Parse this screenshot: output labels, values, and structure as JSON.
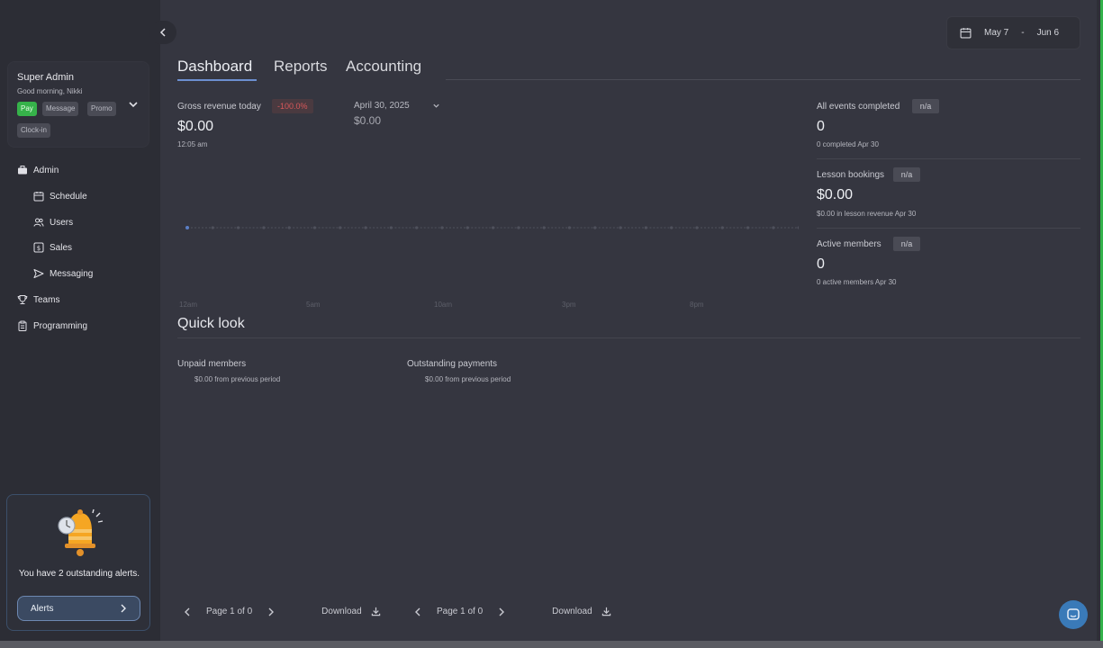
{
  "profile": {
    "name": "Super Admin",
    "greeting": "Good morning, Nikki",
    "chips": [
      "Pay",
      "Message",
      "Promo",
      "Clock-in"
    ]
  },
  "nav": {
    "admin": "Admin",
    "schedule": "Schedule",
    "users": "Users",
    "sales": "Sales",
    "messaging": "Messaging",
    "teams": "Teams",
    "programming": "Programming"
  },
  "alerts": {
    "message": "You have 2 outstanding alerts.",
    "button": "Alerts"
  },
  "date_range": {
    "start": "May 7",
    "separator": "-",
    "end": "Jun 6"
  },
  "tabs": [
    "Dashboard",
    "Reports",
    "Accounting"
  ],
  "revenue": {
    "label": "Gross revenue today",
    "change": "-100.0%",
    "value": "$0.00",
    "time": "12:05 am",
    "compare_date": "April 30, 2025",
    "compare_value": "$0.00"
  },
  "chart_data": {
    "type": "line",
    "x_tick_labels": [
      "12am",
      "5am",
      "10am",
      "3pm",
      "8pm"
    ],
    "points": 24,
    "values": [
      0,
      0,
      0,
      0,
      0,
      0,
      0,
      0,
      0,
      0,
      0,
      0,
      0,
      0,
      0,
      0,
      0,
      0,
      0,
      0,
      0,
      0,
      0,
      0,
      0
    ]
  },
  "stats": {
    "events": {
      "label": "All events completed",
      "badge": "n/a",
      "value": "0",
      "sub": "0 completed Apr 30"
    },
    "lessons": {
      "label": "Lesson bookings",
      "badge": "n/a",
      "value": "$0.00",
      "sub": "$0.00 in lesson revenue Apr 30"
    },
    "members": {
      "label": "Active members",
      "badge": "n/a",
      "value": "0",
      "sub": "0 active members Apr 30"
    }
  },
  "quick_look": {
    "title": "Quick look",
    "unpaid": {
      "label": "Unpaid members",
      "sub": "$0.00 from previous period"
    },
    "outstanding": {
      "label": "Outstanding payments",
      "sub": "$0.00 from previous period"
    }
  },
  "pagers": [
    {
      "page_text": "Page 1 of 0",
      "download": "Download"
    },
    {
      "page_text": "Page 1 of 0",
      "download": "Download"
    }
  ]
}
